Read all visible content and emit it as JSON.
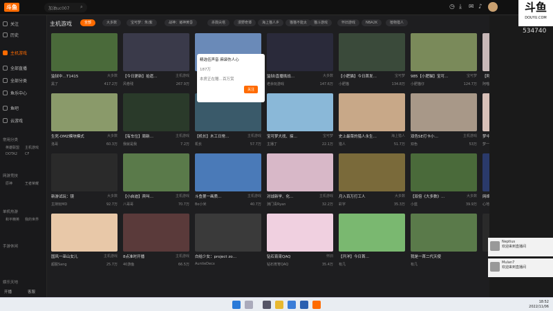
{
  "app": {
    "logo": "斗鱼",
    "search_value": "加油uc007",
    "brand_big": "斗鱼",
    "brand_small": "DOUYU.COM",
    "counter": "534740"
  },
  "sidebar": {
    "items": [
      {
        "label": "关注"
      },
      {
        "label": "历史"
      },
      {
        "label": "主机游戏"
      },
      {
        "label": "全部直播"
      },
      {
        "label": "全部分类"
      },
      {
        "label": "鱼乐中心"
      },
      {
        "label": "鱼吧"
      },
      {
        "label": "云游戏"
      }
    ],
    "groups": [
      "常用分类",
      "网游竞技",
      "单机热游",
      "手游休闲",
      "娱乐天地"
    ],
    "sub": [
      "英雄联盟",
      "主机游戏",
      "DOTA2",
      "CF",
      "原神",
      "王者荣耀",
      "和平精英",
      "我的世界"
    ],
    "bottom_left": "开播",
    "bottom_right": "客服"
  },
  "main": {
    "title": "主机游戏",
    "categories": [
      "全部",
      "大多数",
      "宝可梦：朱/紫",
      "战神：诸神黄昏",
      "杀戮尖塔",
      "漫野奇谭",
      "海上猫人乡",
      "猫猫不能太",
      "猫斗游戏",
      "怀旧游戏",
      "NBA2K",
      "植物猎人"
    ],
    "cards": [
      {
        "title": "监狱中…T1415",
        "user": "黑了",
        "views": "417.2万",
        "cat": "大多数"
      },
      {
        "title": "【今日更新】拾遗…",
        "user": "风卷残",
        "views": "267.9万",
        "cat": "主机游戏"
      },
      {
        "title": "",
        "user": "",
        "views": "",
        "cat": ""
      },
      {
        "title": "监狱I直播挑战…",
        "user": "老余玩游戏",
        "views": "147.6万",
        "cat": "大多数"
      },
      {
        "title": "【小肥猫】今日首发…",
        "user": "小肥猫",
        "views": "134.8万",
        "cat": "宝可梦"
      },
      {
        "title": "985【小肥猫】宝可…",
        "user": "小肥猫仔",
        "views": "124.7万",
        "cat": "宝可梦"
      },
      {
        "title": "【阿喵】周末游戏…",
        "user": "阿喵",
        "views": "95.9万",
        "cat": "主机游戏"
      },
      {
        "title": "生死-DMZ模块模式",
        "user": "洛哥",
        "views": "60.3万",
        "cat": "大多数"
      },
      {
        "title": "【有车位】周新…",
        "user": "我就是我",
        "views": "7.2万",
        "cat": "主机游戏"
      },
      {
        "title": "【机长】木工日常…",
        "user": "机长",
        "views": "57.7万",
        "cat": "主机游戏"
      },
      {
        "title": "宝可梦大找、探…",
        "user": "主播丁",
        "views": "22.1万",
        "cat": "宝可梦"
      },
      {
        "title": "史上最菜的猎人永生…",
        "user": "猎人",
        "views": "51.7万",
        "cat": "海上猎人"
      },
      {
        "title": "双色SE打卡小…",
        "user": "双色",
        "views": "53万",
        "cat": "主机游戏"
      },
      {
        "title": "梦中连麦打卡",
        "user": "梦一",
        "views": "32.7万",
        "cat": "主机游戏"
      },
      {
        "title": "新游试玩：镜",
        "user": "主持玩MD",
        "views": "92.7万",
        "cat": "大多数"
      },
      {
        "title": "【小启迪】宾叫…",
        "user": "八哥哥",
        "views": "70.7万",
        "cat": "主机游戏"
      },
      {
        "title": "斗鱼第一画质…",
        "user": "Bo小米",
        "views": "40.7万",
        "cat": "主机游戏"
      },
      {
        "title": "对战新学、化…",
        "user": "渊门青Ryan",
        "views": "32.2万",
        "cat": "主机游戏"
      },
      {
        "title": "月入百万打工人",
        "user": "彩字",
        "views": "35.3万",
        "cat": "大多数"
      },
      {
        "title": "【双倍《大多数》…",
        "user": "小蓝",
        "views": "39.9万",
        "cat": "大多数"
      },
      {
        "title": "网络起步加油冲",
        "user": "心地仙人",
        "views": "27.9万",
        "cat": "主机游戏"
      },
      {
        "title": "国风一巫山女儿",
        "user": "超脱Sang",
        "views": "25.7万",
        "cat": "主机游戏"
      },
      {
        "title": "8点准时开播",
        "user": "40游鱼",
        "views": "66.5万",
        "cat": "主机游戏"
      },
      {
        "title": "白给少女：project zo…",
        "user": "AuntieDecx",
        "views": "",
        "cat": ""
      },
      {
        "title": "钻石宵宵QAQ",
        "user": "钻石宵宵QAQ",
        "views": "35.4万",
        "cat": "怀旧"
      },
      {
        "title": "【开洋】今日首…",
        "user": "有几",
        "views": "",
        "cat": ""
      },
      {
        "title": "我是一首二代天使",
        "user": "有几",
        "views": "",
        "cat": ""
      },
      {
        "title": "",
        "user": "",
        "views": "",
        "cat": ""
      }
    ]
  },
  "popup": {
    "title": "精选伍声音 麻袋伤人心",
    "views": "187万",
    "desc": "本房正在赠…百万赏",
    "btn": "关注"
  },
  "notifications": [
    {
      "name": "Neptius",
      "msg": "欢迎来到直播间"
    },
    {
      "name": "Mulan7",
      "msg": "欢迎来到直播间"
    }
  ],
  "taskbar": {
    "time": "18:52",
    "date": "2022/11/06"
  },
  "colors": {
    "accent": "#ff6b00",
    "bg": "#1e1e20"
  }
}
